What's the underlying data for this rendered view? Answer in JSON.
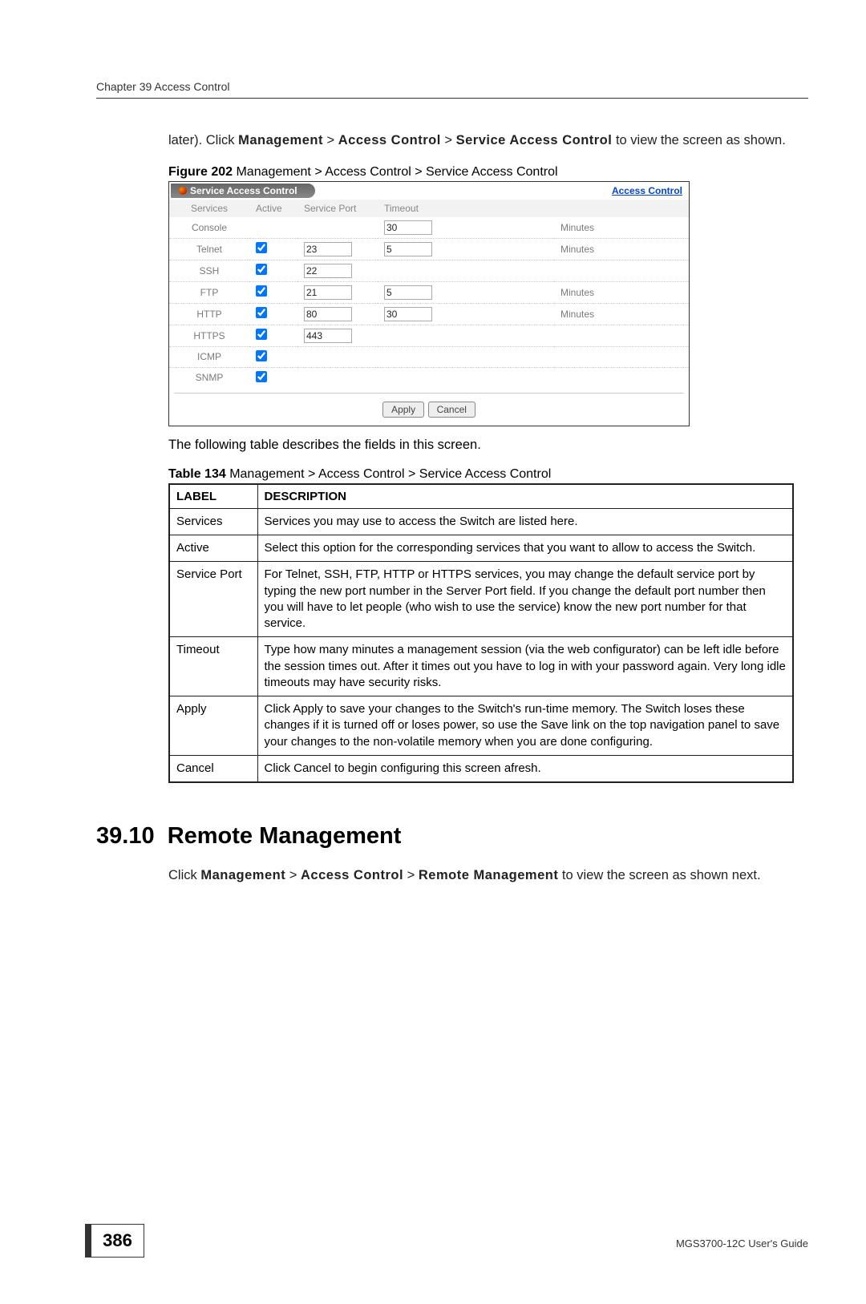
{
  "header": {
    "chapter": "Chapter 39 Access Control"
  },
  "intro": {
    "text1": "later). Click ",
    "nav1": "Management",
    "sep1": " > ",
    "nav2": "Access Control",
    "sep2": " > ",
    "nav3": "Service Access Control",
    "text2": " to view the screen as shown."
  },
  "figure": {
    "label": "Figure 202",
    "caption": "   Management > Access Control > Service Access Control"
  },
  "panel": {
    "tab_title": "Service Access Control",
    "link": "Access Control",
    "headers": {
      "services": "Services",
      "active": "Active",
      "port": "Service Port",
      "timeout": "Timeout"
    },
    "minutes": "Minutes",
    "rows": [
      {
        "service": "Console",
        "active": null,
        "port": "",
        "timeout": "30",
        "unit": true
      },
      {
        "service": "Telnet",
        "active": true,
        "port": "23",
        "timeout": "5",
        "unit": true
      },
      {
        "service": "SSH",
        "active": true,
        "port": "22",
        "timeout": "",
        "unit": false
      },
      {
        "service": "FTP",
        "active": true,
        "port": "21",
        "timeout": "5",
        "unit": true
      },
      {
        "service": "HTTP",
        "active": true,
        "port": "80",
        "timeout": "30",
        "unit": true
      },
      {
        "service": "HTTPS",
        "active": true,
        "port": "443",
        "timeout": "",
        "unit": false
      },
      {
        "service": "ICMP",
        "active": true,
        "port": "",
        "timeout": "",
        "unit": false
      },
      {
        "service": "SNMP",
        "active": true,
        "port": "",
        "timeout": "",
        "unit": false
      }
    ],
    "buttons": {
      "apply": "Apply",
      "cancel": "Cancel"
    }
  },
  "describe_text": "The following table describes the fields in this screen.",
  "table": {
    "label": "Table 134",
    "caption": "   Management > Access Control > Service Access Control",
    "headers": {
      "label": "LABEL",
      "desc": "DESCRIPTION"
    },
    "rows": [
      {
        "label": "Services",
        "desc": "Services you may use to access the Switch are listed here."
      },
      {
        "label": "Active",
        "desc": "Select this option for the corresponding services that you want to allow to access the Switch."
      },
      {
        "label": "Service Port",
        "desc": "For Telnet, SSH, FTP, HTTP or HTTPS services, you may change the default service port by typing the new port number in the Server Port field. If you change the default port number then you will have to let people (who wish to use the service) know the new port number for that service."
      },
      {
        "label": "Timeout",
        "desc": "Type how many minutes a management session (via the web configurator) can be left idle before the session times out. After it times out you have to log in with your password again. Very long idle timeouts may have security risks."
      },
      {
        "label": "Apply",
        "desc": "Click Apply to save your changes to the Switch's run-time memory. The Switch loses these changes if it is turned off or loses power, so use the Save link on the top navigation panel to save your changes to the non-volatile memory when you are done configuring."
      },
      {
        "label": "Cancel",
        "desc": "Click Cancel to begin configuring this screen afresh."
      }
    ]
  },
  "section": {
    "number": "39.10",
    "title": "Remote Management",
    "body1": "Click ",
    "nav1": "Management",
    "sep1": " > ",
    "nav2": "Access Control",
    "sep2": " > ",
    "nav3": "Remote Management",
    "body2": " to view the screen as shown next."
  },
  "footer": {
    "page": "386",
    "guide": "MGS3700-12C User's Guide"
  }
}
